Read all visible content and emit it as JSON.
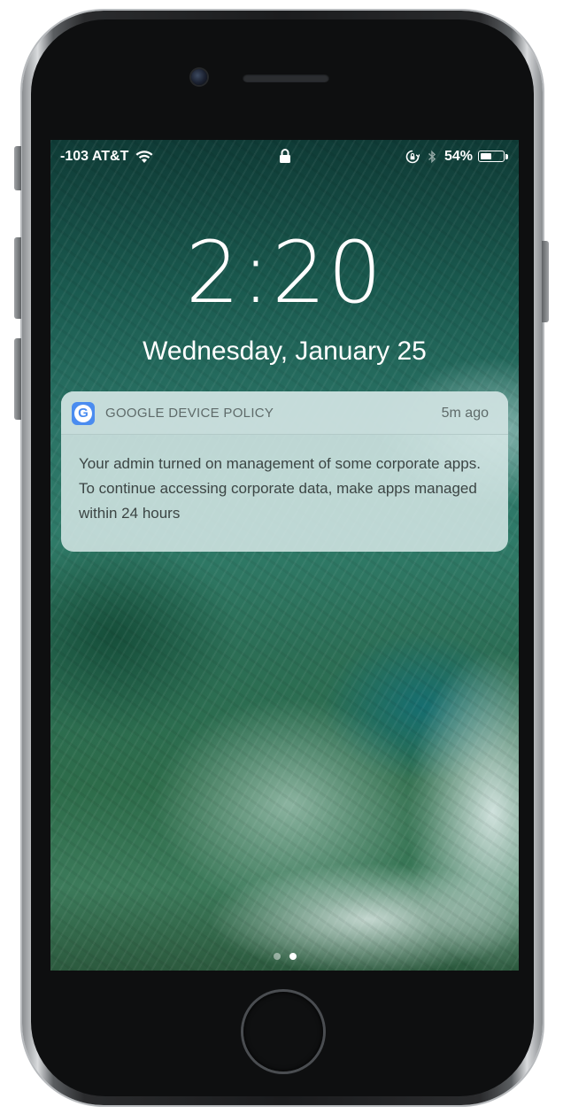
{
  "status_bar": {
    "carrier": "-103 AT&T",
    "battery_percent": "54%",
    "battery_level": 0.54
  },
  "lock_screen": {
    "time": "2:20",
    "date": "Wednesday, January 25"
  },
  "notification": {
    "app_name": "GOOGLE DEVICE POLICY",
    "app_icon_letter": "G",
    "time_ago": "5m ago",
    "message": "Your admin turned on management of some corporate apps. To continue accessing corporate data, make apps managed within 24 hours"
  },
  "page_indicator": {
    "count": 2,
    "active_index": 1
  },
  "colors": {
    "app_icon": "#4a8cf0",
    "notification_bg": "#d6e8e6"
  }
}
